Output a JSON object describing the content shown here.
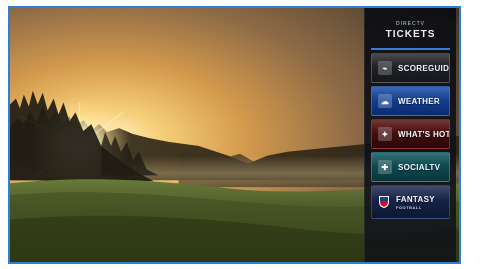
{
  "colors": {
    "frame_border": "#2f7fd6",
    "panel_bg": "#0d0f14",
    "weather": "#1b4fa7",
    "whats_hot": "#5a1515",
    "socialtv": "#125c62",
    "fantasy": "#1f2e56"
  },
  "sidebar": {
    "header": {
      "small": "DIRECTV",
      "title": "TICKETS"
    },
    "items": [
      {
        "id": "scoreguide",
        "label": "SCOREGUIDE",
        "icon": "scoreboard-icon"
      },
      {
        "id": "weather",
        "label": "WEATHER",
        "icon": "weather-icon"
      },
      {
        "id": "whats-hot",
        "label": "WHAT'S HOT",
        "icon": "flame-icon"
      },
      {
        "id": "socialtv",
        "label": "SOCIALTV",
        "icon": "social-icon"
      },
      {
        "id": "fantasy",
        "label": "FANTASY",
        "sublabel": "FOOTBALL",
        "icon": "nfl-shield-icon"
      }
    ]
  }
}
